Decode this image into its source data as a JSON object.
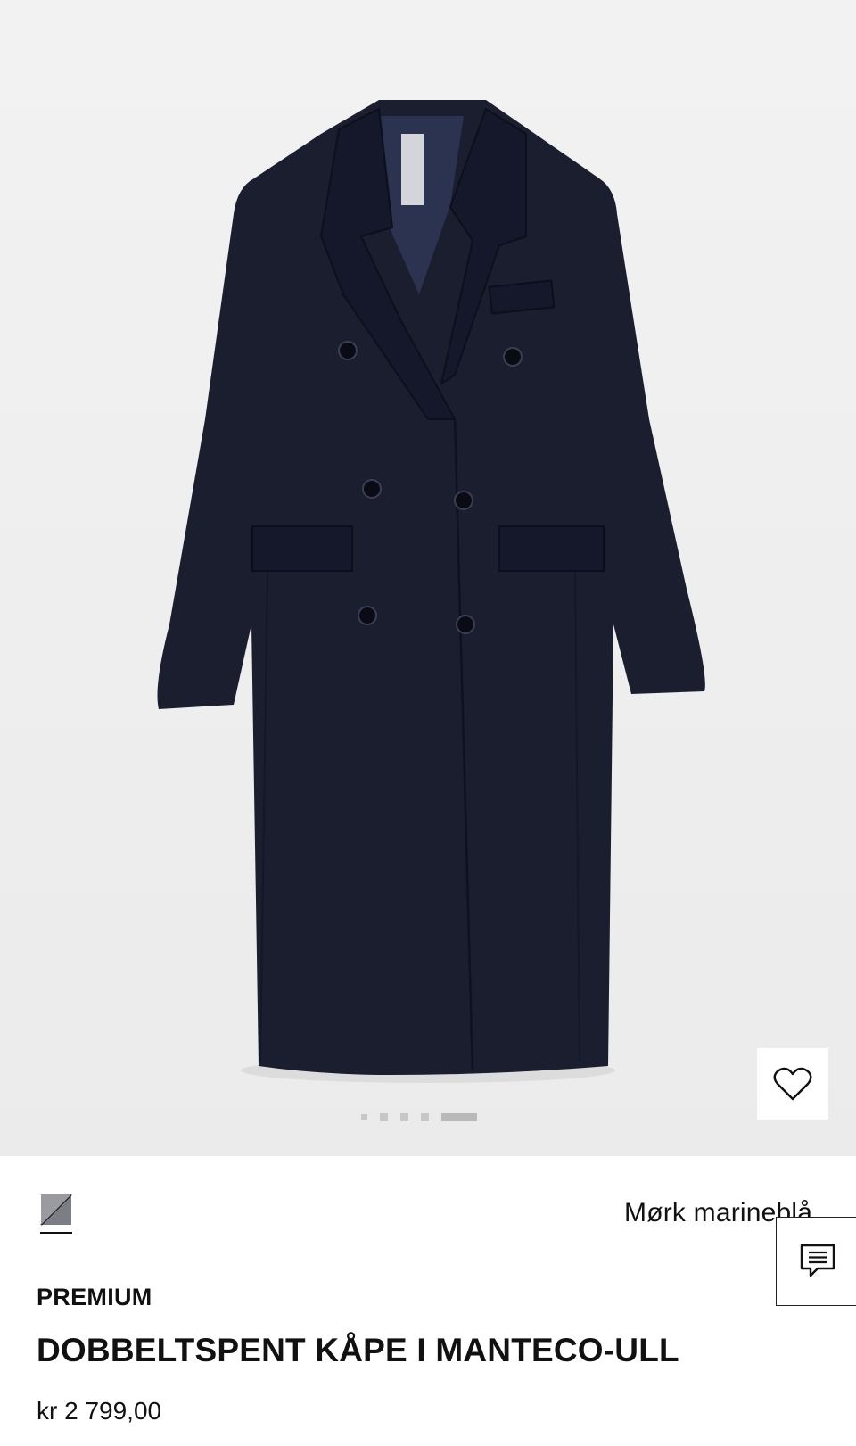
{
  "gallery": {
    "image_alt": "Dark navy double-breasted long wool coat on white background",
    "indicator_count": 5,
    "active_index": 4,
    "favorite_icon": "heart-icon"
  },
  "color": {
    "label": "Mørk marineblå",
    "swatch_icon": "color-swatch-icon",
    "accent": "#1b1e2e"
  },
  "chat": {
    "icon": "chat-icon"
  },
  "product": {
    "line": "PREMIUM",
    "name": "DOBBELTSPENT KÅPE I MANTECO-ULL",
    "price": "kr 2 799,00"
  }
}
